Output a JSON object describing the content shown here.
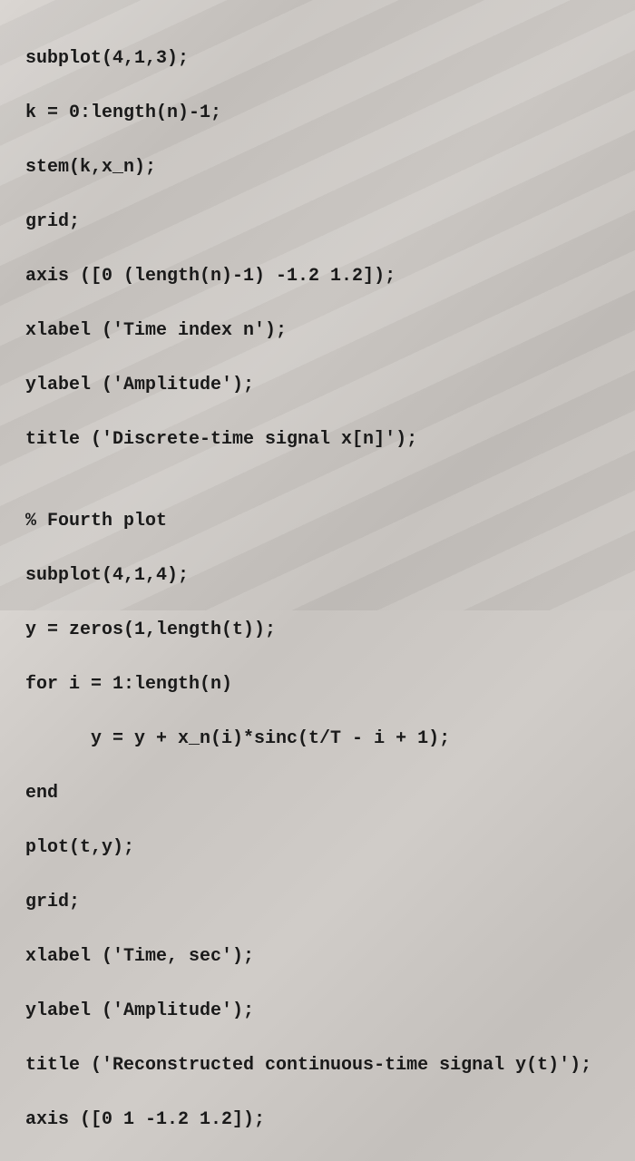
{
  "code": {
    "lines": [
      "subplot(4,1,3);",
      "k = 0:length(n)-1;",
      "stem(k,x_n);",
      "grid;",
      "axis ([0 (length(n)-1) -1.2 1.2]);",
      "xlabel ('Time index n');",
      "ylabel ('Amplitude');",
      "title ('Discrete-time signal x[n]');",
      "",
      "% Fourth plot",
      "subplot(4,1,4);",
      "y = zeros(1,length(t));",
      "for i = 1:length(n)",
      "      y = y + x_n(i)*sinc(t/T - i + 1);",
      "end",
      "plot(t,y);",
      "grid;",
      "xlabel ('Time, sec');",
      "ylabel ('Amplitude');",
      "title ('Reconstructed continuous-time signal y(t)');",
      "axis ([0 1 -1.2 1.2]);"
    ]
  }
}
